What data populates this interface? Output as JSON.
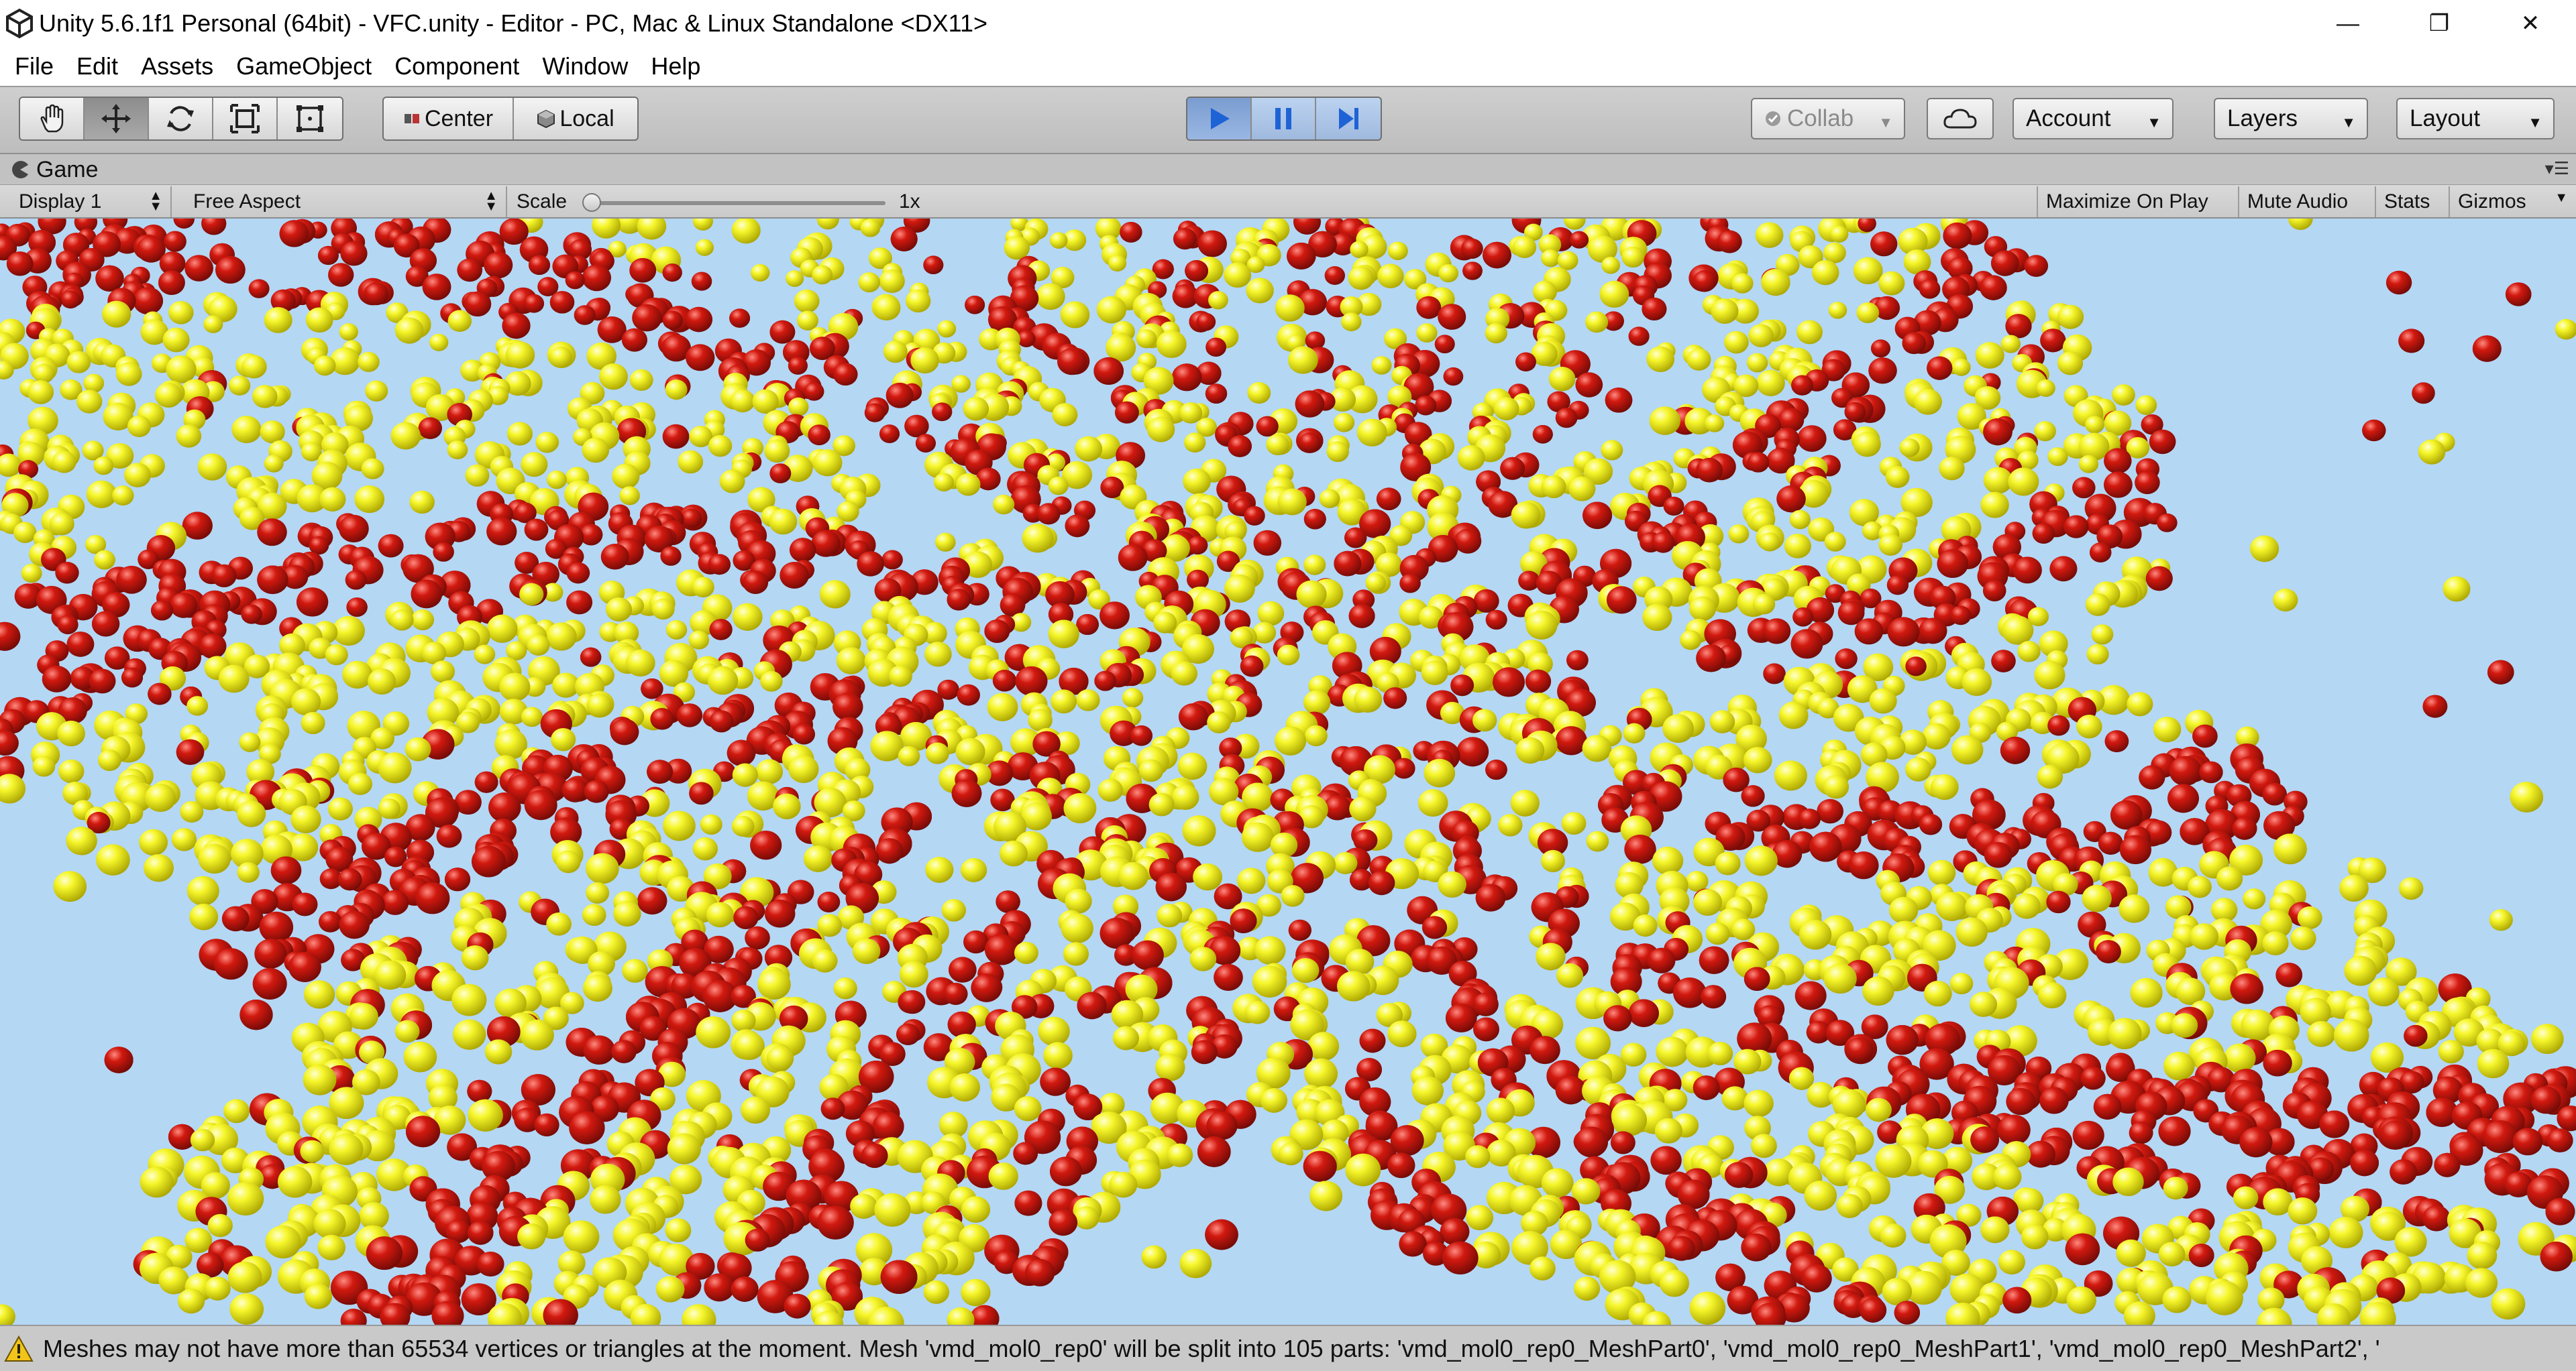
{
  "window": {
    "title": "Unity 5.6.1f1 Personal (64bit) - VFC.unity - Editor - PC, Mac & Linux Standalone <DX11>",
    "minimize": "—",
    "restore": "❐",
    "close": "✕"
  },
  "menu": [
    "File",
    "Edit",
    "Assets",
    "GameObject",
    "Component",
    "Window",
    "Help"
  ],
  "toolbar": {
    "tools": [
      "hand-icon",
      "move-icon",
      "rotate-icon",
      "scale-icon",
      "rect-icon"
    ],
    "active_tool": "move-icon",
    "pivot": "Center",
    "space": "Local",
    "play_state": "playing",
    "collab": "Collab",
    "account": "Account",
    "layers": "Layers",
    "layout": "Layout"
  },
  "game_tab": {
    "label": "Game"
  },
  "game_view": {
    "display": "Display 1",
    "aspect": "Free Aspect",
    "scale_label": "Scale",
    "scale_value": "1x",
    "maximize": "Maximize On Play",
    "mute": "Mute Audio",
    "stats": "Stats",
    "gizmos": "Gizmos"
  },
  "scene": {
    "background": "#b4d7f4",
    "sphere_colors": [
      "#f2f21e",
      "#c8140f"
    ]
  },
  "status": {
    "message": "Meshes may not have more than 65534 vertices or triangles at the moment. Mesh 'vmd_mol0_rep0' will be split into 105 parts: 'vmd_mol0_rep0_MeshPart0', 'vmd_mol0_rep0_MeshPart1', 'vmd_mol0_rep0_MeshPart2', '"
  }
}
